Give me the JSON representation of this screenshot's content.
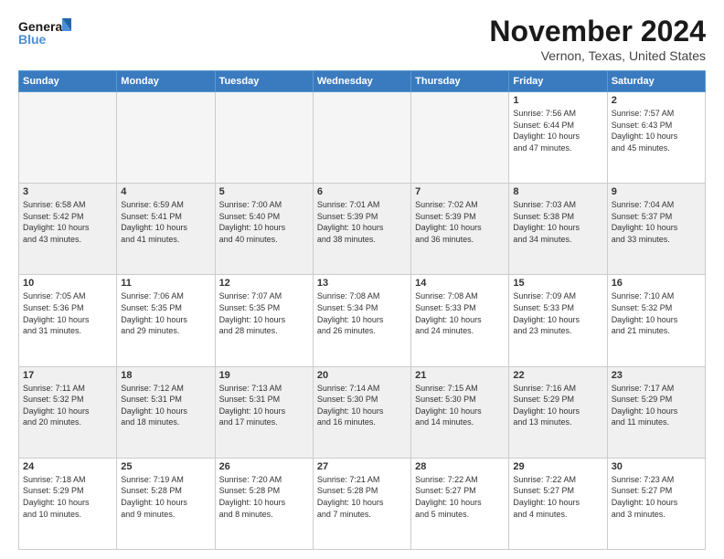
{
  "logo": {
    "line1": "General",
    "line2": "Blue"
  },
  "header": {
    "month": "November 2024",
    "location": "Vernon, Texas, United States"
  },
  "weekdays": [
    "Sunday",
    "Monday",
    "Tuesday",
    "Wednesday",
    "Thursday",
    "Friday",
    "Saturday"
  ],
  "weeks": [
    [
      {
        "day": "",
        "info": ""
      },
      {
        "day": "",
        "info": ""
      },
      {
        "day": "",
        "info": ""
      },
      {
        "day": "",
        "info": ""
      },
      {
        "day": "",
        "info": ""
      },
      {
        "day": "1",
        "info": "Sunrise: 7:56 AM\nSunset: 6:44 PM\nDaylight: 10 hours\nand 47 minutes."
      },
      {
        "day": "2",
        "info": "Sunrise: 7:57 AM\nSunset: 6:43 PM\nDaylight: 10 hours\nand 45 minutes."
      }
    ],
    [
      {
        "day": "3",
        "info": "Sunrise: 6:58 AM\nSunset: 5:42 PM\nDaylight: 10 hours\nand 43 minutes."
      },
      {
        "day": "4",
        "info": "Sunrise: 6:59 AM\nSunset: 5:41 PM\nDaylight: 10 hours\nand 41 minutes."
      },
      {
        "day": "5",
        "info": "Sunrise: 7:00 AM\nSunset: 5:40 PM\nDaylight: 10 hours\nand 40 minutes."
      },
      {
        "day": "6",
        "info": "Sunrise: 7:01 AM\nSunset: 5:39 PM\nDaylight: 10 hours\nand 38 minutes."
      },
      {
        "day": "7",
        "info": "Sunrise: 7:02 AM\nSunset: 5:39 PM\nDaylight: 10 hours\nand 36 minutes."
      },
      {
        "day": "8",
        "info": "Sunrise: 7:03 AM\nSunset: 5:38 PM\nDaylight: 10 hours\nand 34 minutes."
      },
      {
        "day": "9",
        "info": "Sunrise: 7:04 AM\nSunset: 5:37 PM\nDaylight: 10 hours\nand 33 minutes."
      }
    ],
    [
      {
        "day": "10",
        "info": "Sunrise: 7:05 AM\nSunset: 5:36 PM\nDaylight: 10 hours\nand 31 minutes."
      },
      {
        "day": "11",
        "info": "Sunrise: 7:06 AM\nSunset: 5:35 PM\nDaylight: 10 hours\nand 29 minutes."
      },
      {
        "day": "12",
        "info": "Sunrise: 7:07 AM\nSunset: 5:35 PM\nDaylight: 10 hours\nand 28 minutes."
      },
      {
        "day": "13",
        "info": "Sunrise: 7:08 AM\nSunset: 5:34 PM\nDaylight: 10 hours\nand 26 minutes."
      },
      {
        "day": "14",
        "info": "Sunrise: 7:08 AM\nSunset: 5:33 PM\nDaylight: 10 hours\nand 24 minutes."
      },
      {
        "day": "15",
        "info": "Sunrise: 7:09 AM\nSunset: 5:33 PM\nDaylight: 10 hours\nand 23 minutes."
      },
      {
        "day": "16",
        "info": "Sunrise: 7:10 AM\nSunset: 5:32 PM\nDaylight: 10 hours\nand 21 minutes."
      }
    ],
    [
      {
        "day": "17",
        "info": "Sunrise: 7:11 AM\nSunset: 5:32 PM\nDaylight: 10 hours\nand 20 minutes."
      },
      {
        "day": "18",
        "info": "Sunrise: 7:12 AM\nSunset: 5:31 PM\nDaylight: 10 hours\nand 18 minutes."
      },
      {
        "day": "19",
        "info": "Sunrise: 7:13 AM\nSunset: 5:31 PM\nDaylight: 10 hours\nand 17 minutes."
      },
      {
        "day": "20",
        "info": "Sunrise: 7:14 AM\nSunset: 5:30 PM\nDaylight: 10 hours\nand 16 minutes."
      },
      {
        "day": "21",
        "info": "Sunrise: 7:15 AM\nSunset: 5:30 PM\nDaylight: 10 hours\nand 14 minutes."
      },
      {
        "day": "22",
        "info": "Sunrise: 7:16 AM\nSunset: 5:29 PM\nDaylight: 10 hours\nand 13 minutes."
      },
      {
        "day": "23",
        "info": "Sunrise: 7:17 AM\nSunset: 5:29 PM\nDaylight: 10 hours\nand 11 minutes."
      }
    ],
    [
      {
        "day": "24",
        "info": "Sunrise: 7:18 AM\nSunset: 5:29 PM\nDaylight: 10 hours\nand 10 minutes."
      },
      {
        "day": "25",
        "info": "Sunrise: 7:19 AM\nSunset: 5:28 PM\nDaylight: 10 hours\nand 9 minutes."
      },
      {
        "day": "26",
        "info": "Sunrise: 7:20 AM\nSunset: 5:28 PM\nDaylight: 10 hours\nand 8 minutes."
      },
      {
        "day": "27",
        "info": "Sunrise: 7:21 AM\nSunset: 5:28 PM\nDaylight: 10 hours\nand 7 minutes."
      },
      {
        "day": "28",
        "info": "Sunrise: 7:22 AM\nSunset: 5:27 PM\nDaylight: 10 hours\nand 5 minutes."
      },
      {
        "day": "29",
        "info": "Sunrise: 7:22 AM\nSunset: 5:27 PM\nDaylight: 10 hours\nand 4 minutes."
      },
      {
        "day": "30",
        "info": "Sunrise: 7:23 AM\nSunset: 5:27 PM\nDaylight: 10 hours\nand 3 minutes."
      }
    ]
  ],
  "gray_rows": [
    1,
    3
  ]
}
